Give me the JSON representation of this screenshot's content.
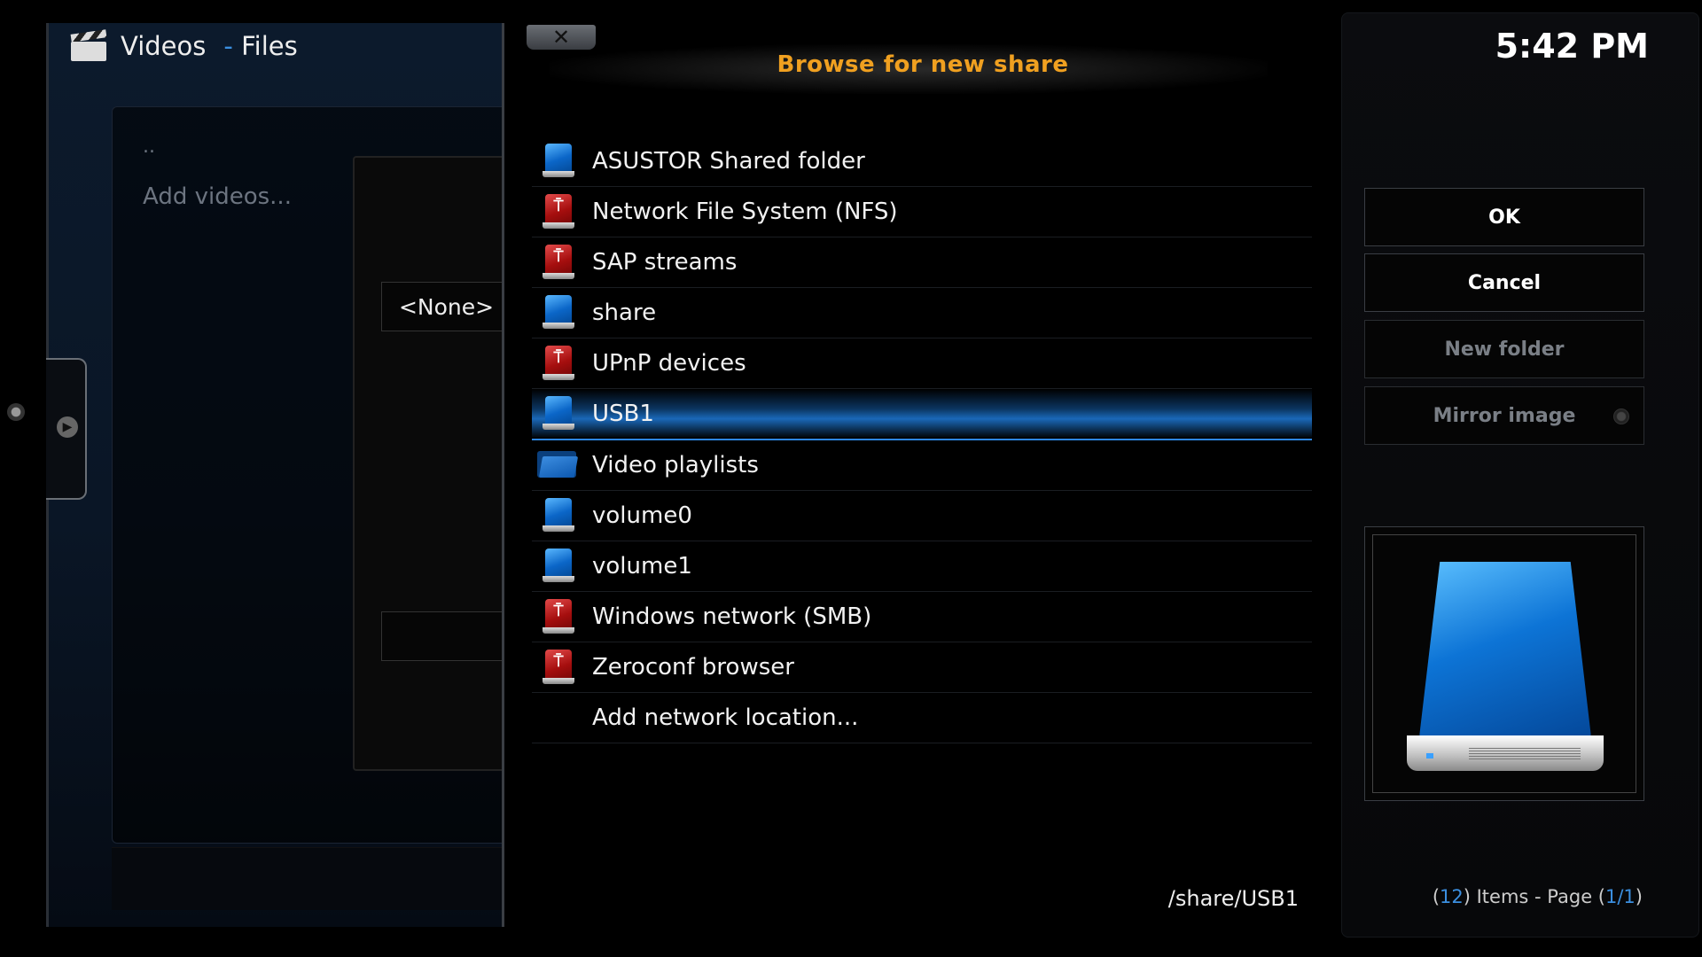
{
  "background": {
    "window_title": "Videos",
    "window_separator": "-",
    "window_section": "Files",
    "list_items": [
      "..",
      "Add videos..."
    ],
    "add_source_field": "<None>"
  },
  "dialog": {
    "close_label": "✕",
    "title": "Browse for new share",
    "items": [
      {
        "label": "ASUSTOR Shared folder",
        "icon": "drive-icon"
      },
      {
        "label": "Network File System (NFS)",
        "icon": "network-icon"
      },
      {
        "label": "SAP streams",
        "icon": "network-icon"
      },
      {
        "label": "share",
        "icon": "drive-icon"
      },
      {
        "label": "UPnP devices",
        "icon": "network-icon"
      },
      {
        "label": "USB1",
        "icon": "drive-icon",
        "selected": true
      },
      {
        "label": "Video playlists",
        "icon": "folder-icon"
      },
      {
        "label": "volume0",
        "icon": "drive-icon"
      },
      {
        "label": "volume1",
        "icon": "drive-icon"
      },
      {
        "label": "Windows network (SMB)",
        "icon": "network-icon"
      },
      {
        "label": "Zeroconf browser",
        "icon": "network-icon"
      },
      {
        "label": "Add network location...",
        "icon": ""
      }
    ],
    "current_path": "/share/USB1"
  },
  "right_panel": {
    "clock": "5:42 PM",
    "buttons": {
      "ok": "OK",
      "cancel": "Cancel",
      "new_folder": "New folder",
      "mirror_image": "Mirror image"
    },
    "preview_icon": "hard-drive-icon",
    "items_count": "12",
    "items_text": ") Items - Page (",
    "page": "1/1",
    "open_paren": "(",
    "close_paren": ")"
  },
  "colors": {
    "title_accent": "#f0a020",
    "highlight_blue": "#3b8fe0",
    "selection": "#1a68b8"
  }
}
